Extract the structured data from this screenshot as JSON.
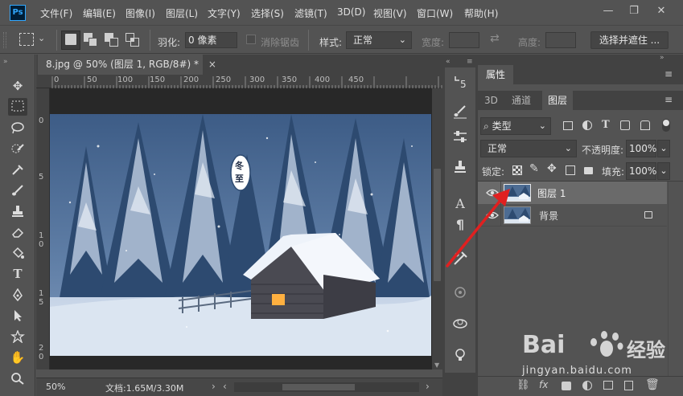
{
  "app": {
    "logo": "Ps"
  },
  "menu": [
    "文件(F)",
    "编辑(E)",
    "图像(I)",
    "图层(L)",
    "文字(Y)",
    "选择(S)",
    "滤镜(T)",
    "3D(D)",
    "视图(V)",
    "窗口(W)",
    "帮助(H)"
  ],
  "window_controls": {
    "minimize": "—",
    "restore": "❐",
    "close": "✕"
  },
  "options": {
    "feather_label": "羽化:",
    "feather_value": "0 像素",
    "antialias_label": "消除锯齿",
    "style_label": "样式:",
    "style_value": "正常",
    "width_label": "宽度:",
    "height_label": "高度:",
    "select_mask_button": "选择并遮住 ..."
  },
  "document": {
    "tab_title": "8.jpg @ 50% (图层 1, RGB/8#) *",
    "close": "×",
    "zoom": "50%",
    "doc_info": "文档:1.65M/3.30M"
  },
  "rulers": {
    "top": [
      "0",
      "50",
      "100",
      "150",
      "200",
      "250",
      "300",
      "350",
      "400",
      "450"
    ],
    "left": [
      "0",
      "5",
      "1 0",
      "1 5",
      "2 0"
    ]
  },
  "artwork": {
    "stamp_text_top": "冬",
    "stamp_text_bottom": "至"
  },
  "panels": {
    "properties_tab": "属性",
    "tabs": [
      "3D",
      "通道",
      "图层"
    ],
    "active_tab": "图层",
    "filter_kind": "类型",
    "blend_mode": "正常",
    "opacity_label": "不透明度:",
    "opacity_value": "100%",
    "lock_label": "锁定:",
    "fill_label": "填充:",
    "fill_value": "100%"
  },
  "layers": [
    {
      "name": "图层 1",
      "selected": true,
      "locked": false
    },
    {
      "name": "背景",
      "selected": false,
      "locked": true
    }
  ],
  "watermark": {
    "brand": "Bai",
    "brand_suffix": "经验",
    "url": "jingyan.baidu.com"
  },
  "colors": {
    "accent_arrow": "#e02020",
    "selected_layer": "#6a6a6a",
    "ps_blue": "#31a8ff"
  }
}
